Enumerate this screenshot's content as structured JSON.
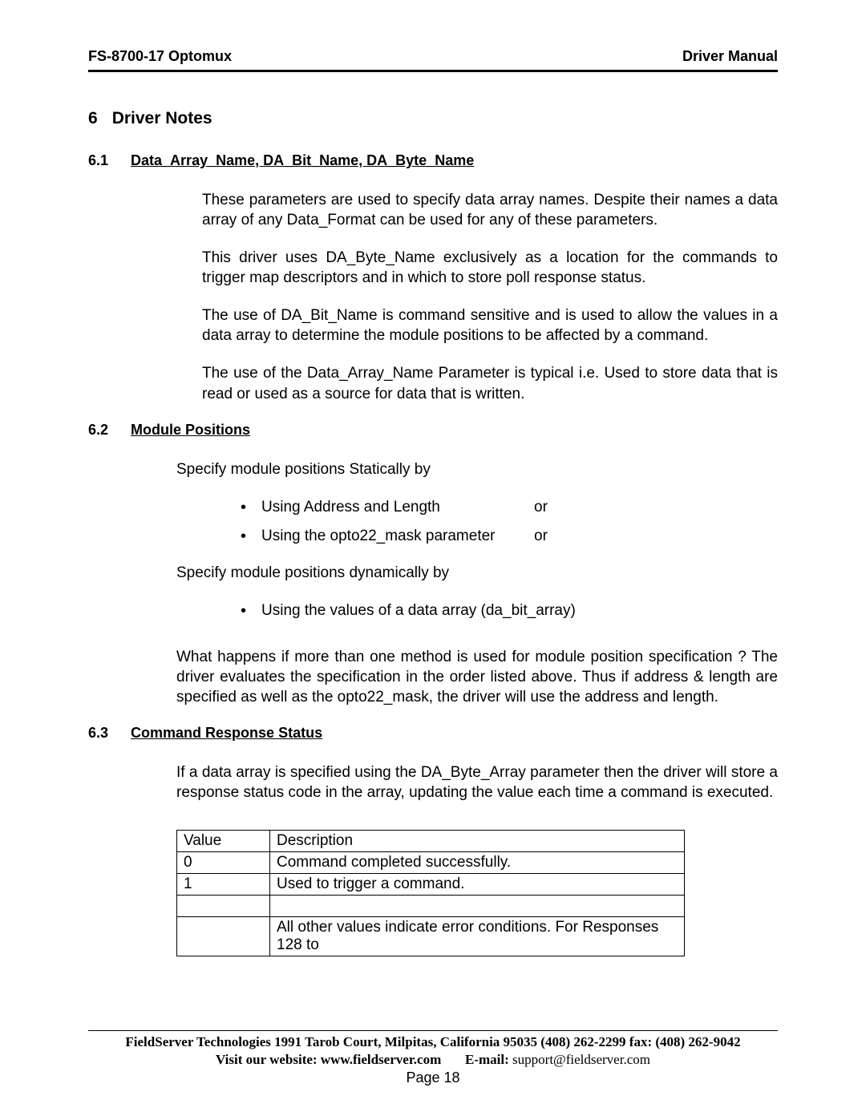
{
  "header": {
    "left": "FS-8700-17 Optomux",
    "right": "Driver Manual"
  },
  "sections": {
    "s6": {
      "num": "6",
      "title": "Driver Notes"
    },
    "s6_1": {
      "num": "6.1",
      "title": "Data_Array_Name, DA_Bit_Name, DA_Byte_Name",
      "p1": "These parameters are used to specify data array names. Despite their names a data array of any Data_Format can be used for any of these parameters.",
      "p2": "This driver uses DA_Byte_Name exclusively as a  location for the commands to trigger map descriptors and in which to store poll response status.",
      "p3": "The use of   DA_Bit_Name  is command sensitive and is used to allow the values in a data array to determine the module positions to be affected by a command.",
      "p4": "The use of the Data_Array_Name Parameter is typical  i.e. Used to store data that is read or used as a source for data that is written."
    },
    "s6_2": {
      "num": "6.2",
      "title": "Module Positions",
      "intro1": "Specify module positions Statically by",
      "bullets1": [
        {
          "text": "Using Address and Length",
          "or": "or"
        },
        {
          "text": "Using the opto22_mask parameter",
          "or": "or"
        }
      ],
      "intro2": "Specify module positions dynamically by",
      "bullets2": [
        {
          "text": "Using the values of a data array (da_bit_array)",
          "or": ""
        }
      ],
      "p_after": "What happens if more than one method is used for module position specification ?  The driver evaluates the specification in the order listed above. Thus if address & length are specified as well as the opto22_mask, the driver will use the address and length."
    },
    "s6_3": {
      "num": "6.3",
      "title": "Command Response Status",
      "p1": "If a data array is specified using the DA_Byte_Array parameter then the driver will store a response status code in the array, updating the value each time a command is executed.",
      "table": {
        "head": {
          "c1": "Value",
          "c2": "Description"
        },
        "rows": [
          {
            "c1": "0",
            "c2": "Command completed successfully."
          },
          {
            "c1": "1",
            "c2": "Used to trigger a command."
          },
          {
            "c1": "",
            "c2": ""
          },
          {
            "c1": "",
            "c2": "All other values indicate error conditions.  For Responses 128 to"
          }
        ]
      }
    }
  },
  "footer": {
    "l1": "FieldServer Technologies 1991 Tarob Court, Milpitas, California 95035 (408) 262-2299 fax: (408) 262-9042",
    "l2_a": "Visit our website: www.fieldserver.com",
    "l2_b": "E-mail:",
    "l2_c": "support@fieldserver.com",
    "page": "Page 18"
  }
}
